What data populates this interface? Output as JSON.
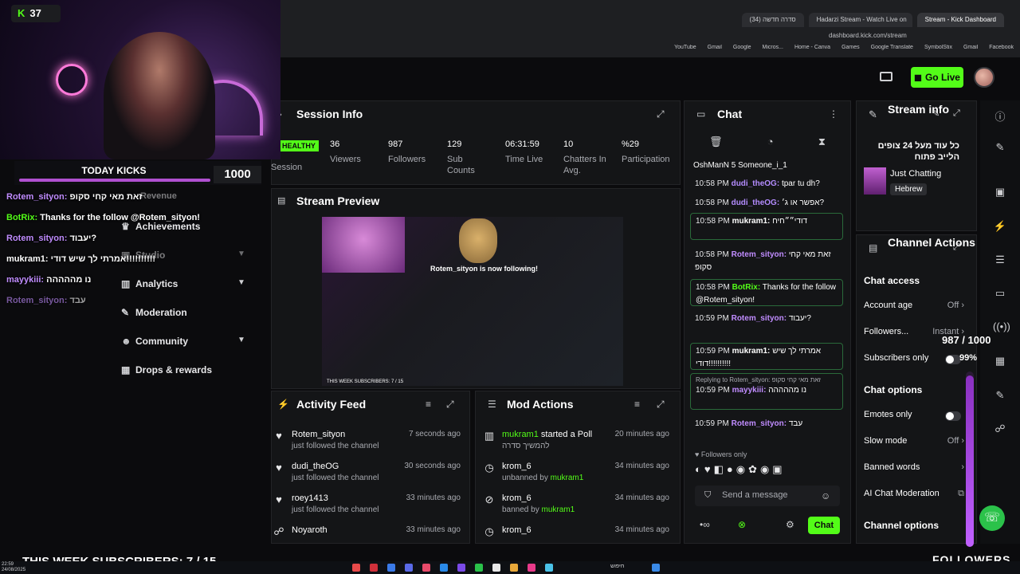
{
  "browser": {
    "tabs": [
      "סדרה חדשה (34)",
      "Hadarzi Stream - Watch Live on",
      "Stream - Kick Dashboard"
    ],
    "url": "dashboard.kick.com/stream",
    "bookmarks": [
      "YouTube",
      "Gmail",
      "Google",
      "Micros...",
      "Home - Canva",
      "Games",
      "Google Translate",
      "SymbolStix",
      "Gmail",
      "Facebook"
    ]
  },
  "header": {
    "go_live": "Go Live"
  },
  "overlay": {
    "kick_count": "37",
    "today_label": "TODAY KICKS",
    "today_value": "1000",
    "weekly_subs": "THIS WEEK SUBSCRIBERS: 7 / 15",
    "followers_label": "FOLLOWERS",
    "followers_goal": "987 / 1000",
    "followers_pct": "99%",
    "followers_progress": 0.987,
    "chat": [
      {
        "user": "Rotem_sityon:",
        "text": "זאת מאי קחי סקופ",
        "color": "purple"
      },
      {
        "user": "BotRix:",
        "text": "Thanks for the follow @Rotem_sityon!",
        "color": "green"
      },
      {
        "user": "Rotem_sityon:",
        "text": "יעבוד?",
        "color": "purple"
      },
      {
        "user": "mukram1:",
        "text": "אמרתי לך שיש דודי!!!!!!!!!!",
        "color": "white"
      },
      {
        "user": "mayykiii:",
        "text": "נו מההההה",
        "color": "purple"
      },
      {
        "user": "Rotem_sityon:",
        "text": "עבד",
        "color": "purple"
      }
    ]
  },
  "nav": {
    "items": [
      {
        "label": "Achievements",
        "icon": "trophy-icon"
      },
      {
        "label": "Studio",
        "icon": "studio-icon"
      },
      {
        "label": "Analytics",
        "icon": "chart-icon"
      },
      {
        "label": "Moderation",
        "icon": "wrench-icon"
      },
      {
        "label": "Community",
        "icon": "people-icon"
      },
      {
        "label": "Drops & rewards",
        "icon": "gift-icon"
      }
    ],
    "revenue_label": "Revenue"
  },
  "session": {
    "title": "Session Info",
    "health": "HEALTHY",
    "health_label": "Session",
    "stats": [
      {
        "value": "36",
        "label": "Viewers"
      },
      {
        "value": "987",
        "label": "Followers"
      },
      {
        "value": "129",
        "label": "Sub Counts"
      },
      {
        "value": "06:31:59",
        "label": "Time Live"
      },
      {
        "value": "10",
        "label": "Chatters In Avg."
      },
      {
        "value": "%29",
        "label": "Participation"
      }
    ]
  },
  "preview": {
    "title": "Stream Preview",
    "follow_text": "Rotem_sityon is now following!",
    "sub_text": "THIS WEEK SUBSCRIBERS: 7 / 15"
  },
  "activity": {
    "title": "Activity Feed",
    "items": [
      {
        "name": "Rotem_sityon",
        "sub": "just followed the channel",
        "time": "7 seconds ago"
      },
      {
        "name": "dudi_theOG",
        "sub": "just followed the channel",
        "time": "30 seconds ago"
      },
      {
        "name": "roey1413",
        "sub": "just followed the channel",
        "time": "33 minutes ago"
      },
      {
        "name": "Noyaroth",
        "sub": "",
        "time": "33 minutes ago"
      }
    ]
  },
  "mod": {
    "title": "Mod Actions",
    "items": [
      {
        "name": "mukram1",
        "action": "started a Poll",
        "sub": "להמשיך סדרה",
        "by": "",
        "time": "20 minutes ago"
      },
      {
        "name": "krom_6",
        "action": "",
        "sub": "unbanned by",
        "by": "mukram1",
        "time": "34 minutes ago"
      },
      {
        "name": "krom_6",
        "action": "",
        "sub": "banned by",
        "by": "mukram1",
        "time": "34 minutes ago"
      },
      {
        "name": "krom_6",
        "action": "",
        "sub": "",
        "by": "",
        "time": "34 minutes ago"
      }
    ]
  },
  "chat": {
    "title": "Chat",
    "top_users": "OshManN 5   Someone_i_1",
    "messages": [
      {
        "time": "10:58 PM",
        "user": "dudi_theOG:",
        "text": "tpar tu dh?",
        "color": "#b48cff",
        "boxed": false
      },
      {
        "time": "10:58 PM",
        "user": "dudi_theOG:",
        "text": "אפשר או ג׳?",
        "color": "#b48cff",
        "boxed": false
      },
      {
        "time": "10:58 PM",
        "user": "mukram1:",
        "text": "דודי״״חיח",
        "color": "#ffffff",
        "boxed": true
      },
      {
        "time": "10:58 PM",
        "user": "Rotem_sityon:",
        "text": "זאת מאי קחי סקופ",
        "color": "#c08cff",
        "boxed": false
      },
      {
        "time": "10:58 PM",
        "user": "BotRix:",
        "text": "Thanks for the follow @Rotem_sityon!",
        "color": "#53fc18",
        "boxed": true
      },
      {
        "time": "10:59 PM",
        "user": "Rotem_sityon:",
        "text": "יעבוד?",
        "color": "#c08cff",
        "boxed": false
      },
      {
        "time": "10:59 PM",
        "user": "mukram1:",
        "text": "אמרתי לך שיש דודי!!!!!!!!!!",
        "color": "#ffffff",
        "boxed": true
      },
      {
        "time": "10:59 PM",
        "user": "mayykiii:",
        "text": "נו מההההה",
        "color": "#c08cff",
        "boxed": true,
        "reply": "Replying to Rotem_sityon: זאת מאי קחי סקופ"
      },
      {
        "time": "10:59 PM",
        "user": "Rotem_sityon:",
        "text": "עבד",
        "color": "#c08cff",
        "boxed": false
      }
    ],
    "followers_only": "Followers only",
    "placeholder": "Send a message",
    "send_label": "Chat"
  },
  "stream_info": {
    "title": "Stream info",
    "description": "כל עוד מעל 24 צופים הלייב פתוח",
    "category": "Just Chatting",
    "language": "Hebrew"
  },
  "channel_actions": {
    "title": "Channel Actions",
    "chat_access": "Chat access",
    "rows_access": [
      {
        "label": "Account age",
        "value": "Off"
      },
      {
        "label": "Followers...",
        "value": "Instant"
      },
      {
        "label": "Subscribers only",
        "value": ""
      }
    ],
    "chat_options": "Chat options",
    "rows_options": [
      {
        "label": "Emotes only",
        "value": ""
      },
      {
        "label": "Slow mode",
        "value": "Off"
      },
      {
        "label": "Banned words",
        "value": ""
      },
      {
        "label": "AI Chat Moderation",
        "value": ""
      }
    ],
    "channel_options": "Channel options"
  },
  "colors": {
    "accent": "#53fc18",
    "panel": "#141517",
    "purple": "#c08cff"
  },
  "taskbar": {
    "time": "22:59",
    "date": "24/08/2025",
    "search": "חיפוש"
  }
}
